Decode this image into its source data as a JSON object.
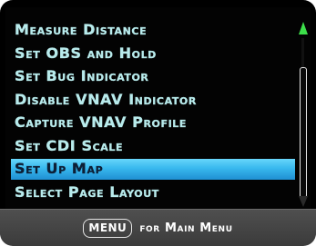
{
  "menu": {
    "items": [
      {
        "label": "Measure Distance",
        "selected": false
      },
      {
        "label": "Set OBS and Hold",
        "selected": false
      },
      {
        "label": "Set Bug Indicator",
        "selected": false
      },
      {
        "label": "Disable VNAV Indicator",
        "selected": false
      },
      {
        "label": "Capture VNAV Profile",
        "selected": false
      },
      {
        "label": "Set CDI Scale",
        "selected": false
      },
      {
        "label": "Set Up Map",
        "selected": true
      },
      {
        "label": "Select Page Layout",
        "selected": false
      }
    ]
  },
  "footer": {
    "key_label": "MENU",
    "hint_text": "for Main Menu"
  },
  "colors": {
    "text": "#b8ebec",
    "highlight": "#38b8ee",
    "scroll_up_arrow": "#3ddf4a",
    "footer_bg": "#4f4f4f"
  },
  "icons": [
    "scroll-up-arrow-icon",
    "scroll-down-arrow-icon"
  ]
}
